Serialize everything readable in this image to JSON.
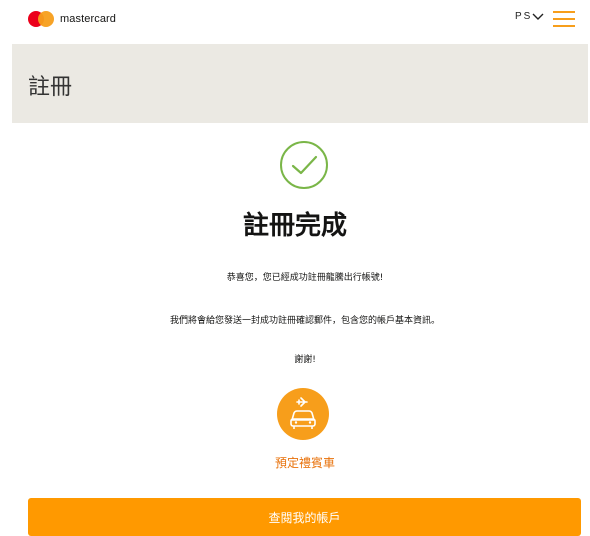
{
  "header": {
    "brand": "mastercard",
    "language": "PS",
    "menu_icon": "hamburger-menu-icon"
  },
  "banner": {
    "title": "註冊"
  },
  "main": {
    "success_icon": "checkmark-circle-icon",
    "heading": "註冊完成",
    "message_1": "恭喜您，您已經成功註冊龍騰出行帳號!",
    "message_2": "我們將會給您發送一封成功註冊確認郵件，包含您的帳戶基本資訊。",
    "message_3": "謝謝!",
    "service_icon": "airport-car-icon",
    "service_label": "預定禮賓車",
    "cta_label": "查閱我的帳戶"
  },
  "colors": {
    "brand_red": "#eb001b",
    "brand_orange": "#f79e1b",
    "cta": "#ff9900",
    "link_orange": "#e8710a",
    "success_green": "#7ab648",
    "banner_bg": "#ebe9e3"
  }
}
